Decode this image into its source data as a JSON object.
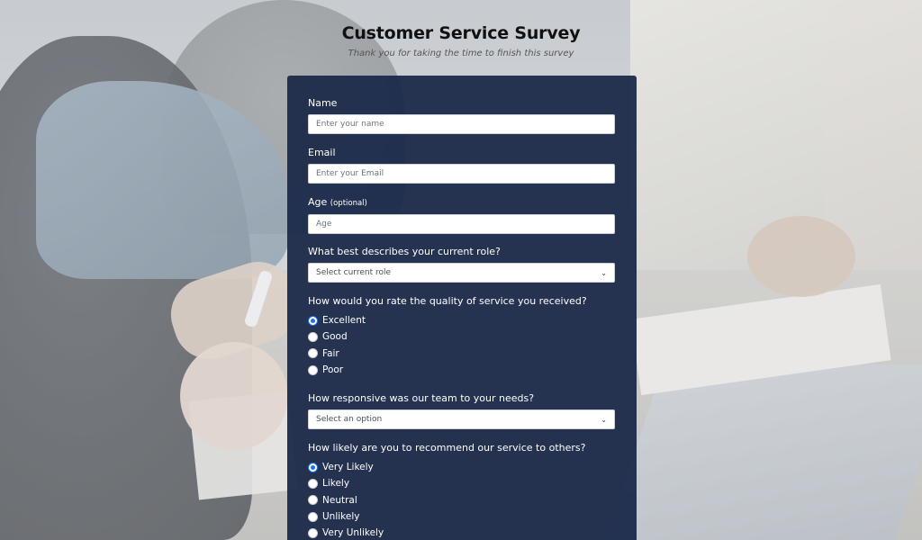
{
  "header": {
    "title": "Customer Service Survey",
    "subtitle": "Thank you for taking the time to finish this survey"
  },
  "form": {
    "name": {
      "label": "Name",
      "placeholder": "Enter your name"
    },
    "email": {
      "label": "Email",
      "placeholder": "Enter your Email"
    },
    "age": {
      "label": "Age",
      "optional": "(optional)",
      "placeholder": "Age"
    },
    "role": {
      "label": "What best describes your current role?",
      "selected": "Select current role"
    },
    "rating": {
      "label": "How would you rate the quality of service you received?",
      "options": [
        "Excellent",
        "Good",
        "Fair",
        "Poor"
      ],
      "selected": "Excellent"
    },
    "responsiveness": {
      "label": "How responsive was our team to your needs?",
      "selected": "Select an option"
    },
    "recommend": {
      "label": "How likely are you to recommend our service to others?",
      "options": [
        "Very Likely",
        "Likely",
        "Neutral",
        "Unlikely",
        "Very Unlikely"
      ],
      "selected": "Very Likely"
    }
  },
  "icons": {
    "select_chevron": "chevron-down-icon"
  },
  "colors": {
    "panel": "#1b2a4a",
    "radio_accent": "#1a73e8"
  }
}
